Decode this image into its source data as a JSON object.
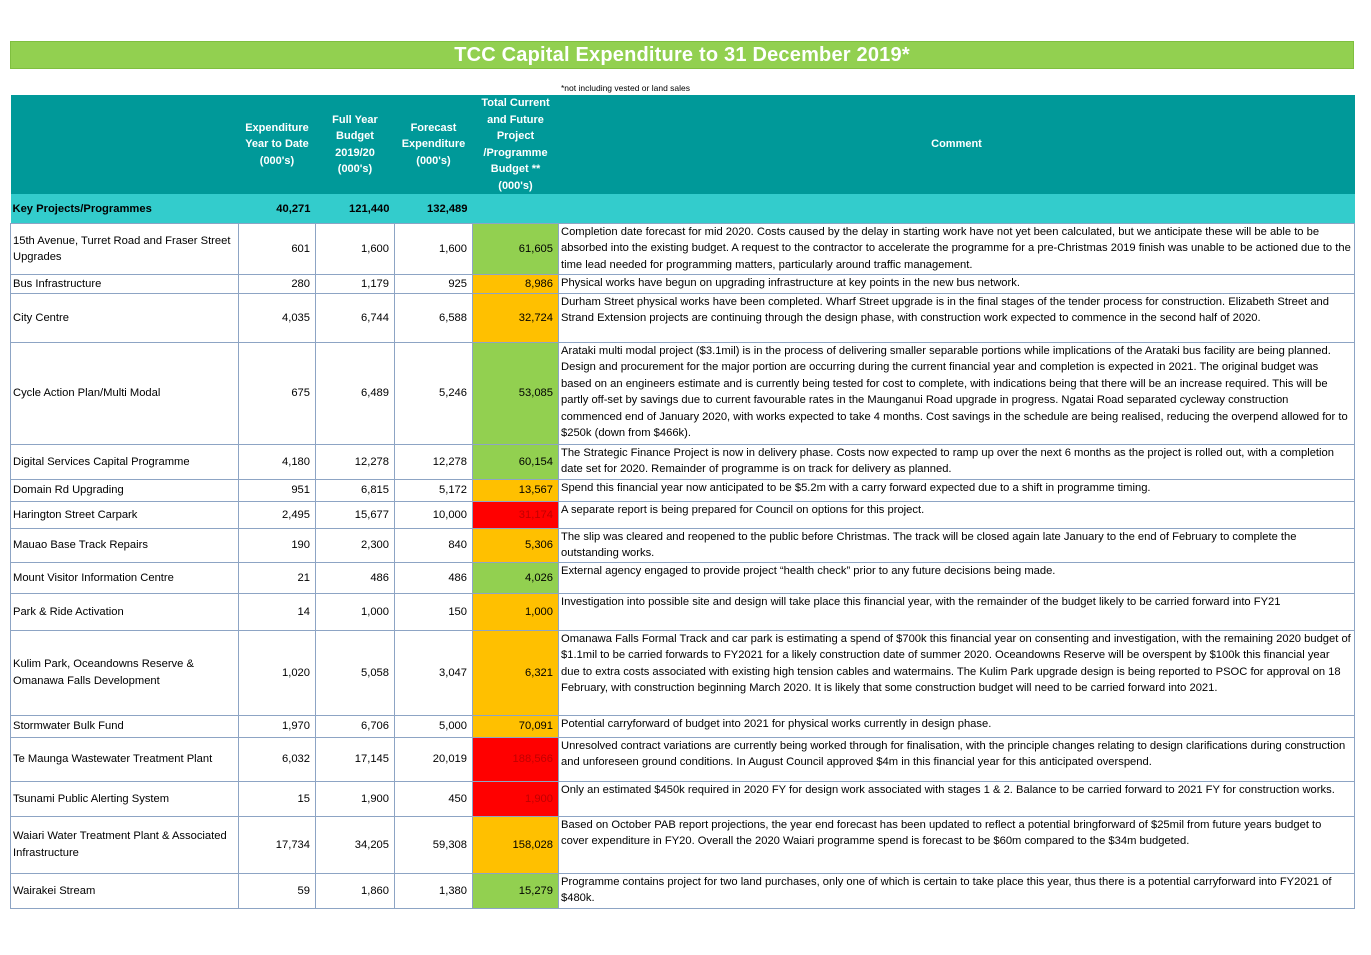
{
  "title": "TCC Capital Expenditure to 31 December 2019*",
  "footnote": "*not including vested or land sales",
  "headers": {
    "expenditure_ytd": "Expenditure Year to Date (000's)",
    "full_year_budget": "Full Year Budget 2019/20 (000's)",
    "forecast": "Forecast Expenditure (000's)",
    "total_budget": "Total Current and Future Project /Programme Budget ** (000's)",
    "comment": "Comment"
  },
  "key_row": {
    "label": "Key Projects/Programmes",
    "expenditure_ytd": "40,271",
    "full_year_budget": "121,440",
    "forecast": "132,489"
  },
  "status_colors": {
    "green": "#92d050",
    "amber": "#ffc000",
    "red": "#ff0000"
  },
  "rows": [
    {
      "name": "15th Avenue, Turret Road and Fraser Street Upgrades",
      "ytd": "601",
      "budget": "1,600",
      "forecast": "1,600",
      "total": "61,605",
      "status": "green",
      "comment": "Completion date forecast for mid 2020.  Costs caused by the delay in starting work have not yet been calculated, but we anticipate these will be able to be absorbed into the existing budget.  A request to the contractor to accelerate the programme for a pre-Christmas 2019 finish was unable to be actioned due to the time lead needed for programming matters, particularly around traffic management."
    },
    {
      "name": "Bus Infrastructure",
      "ytd": "280",
      "budget": "1,179",
      "forecast": "925",
      "total": "8,986",
      "status": "amber",
      "comment": "Physical works have begun on upgrading infrastructure at key points in the new bus network."
    },
    {
      "name": "City Centre",
      "ytd": "4,035",
      "budget": "6,744",
      "forecast": "6,588",
      "total": "32,724",
      "status": "amber",
      "comment": "Durham Street physical works have been completed.  Wharf Street upgrade is in the final stages of the tender process for construction.  Elizabeth Street and Strand Extension projects are continuing through the design phase, with construction work expected to commence in the second half of 2020."
    },
    {
      "name": "Cycle Action Plan/Multi Modal",
      "ytd": "675",
      "budget": "6,489",
      "forecast": "5,246",
      "total": "53,085",
      "status": "green",
      "comment": "Arataki multi modal project ($3.1mil) is in the process of delivering smaller separable portions while implications of the Arataki bus facility are being planned. Design and procurement for the major portion are occurring during the current financial year and completion is expected in 2021.  The original budget was based on an engineers estimate and is currently being tested for cost to complete, with indications being that there will be an increase required.  This will be partly off-set by savings due to current favourable rates in the Maunganui Road upgrade in progress.  Ngatai Road separated cycleway construction commenced end of January 2020, with works expected to take 4 months.  Cost savings in the schedule are being realised, reducing the overpend allowed for to $250k (down from $466k)."
    },
    {
      "name": "Digital Services Capital Programme",
      "ytd": "4,180",
      "budget": "12,278",
      "forecast": "12,278",
      "total": "60,154",
      "status": "green",
      "comment": "The Strategic Finance Project is now in delivery phase.  Costs now expected to ramp up over the next 6 months as the project is rolled out, with a completion date set for 2020.  Remainder of programme is on track for delivery as planned."
    },
    {
      "name": "Domain Rd Upgrading",
      "ytd": "951",
      "budget": "6,815",
      "forecast": "5,172",
      "total": "13,567",
      "status": "amber",
      "comment": "Spend this financial year now anticipated to be $5.2m with a carry forward expected due to a shift in programme timing."
    },
    {
      "name": "Harington Street Carpark",
      "ytd": "2,495",
      "budget": "15,677",
      "forecast": "10,000",
      "total": "31,174",
      "status": "red",
      "comment": "A separate report is being prepared for Council on options for this project."
    },
    {
      "name": "Mauao Base Track Repairs",
      "ytd": "190",
      "budget": "2,300",
      "forecast": "840",
      "total": "5,306",
      "status": "amber",
      "comment": "The slip was cleared and reopened to the public before Christmas.  The track will be closed again late January to the end of February to complete the outstanding works."
    },
    {
      "name": "Mount Visitor Information Centre",
      "ytd": "21",
      "budget": "486",
      "forecast": "486",
      "total": "4,026",
      "status": "green",
      "comment": "External agency engaged to provide project “health check” prior to any future decisions being made."
    },
    {
      "name": "Park & Ride Activation",
      "ytd": "14",
      "budget": "1,000",
      "forecast": "150",
      "total": "1,000",
      "status": "amber",
      "comment": "Investigation into possible site and design will take place this financial year, with the remainder of the budget likely to be carried forward into FY21"
    },
    {
      "name": "Kulim Park, Oceandowns Reserve & Omanawa Falls Development",
      "ytd": "1,020",
      "budget": "5,058",
      "forecast": "3,047",
      "total": "6,321",
      "status": "amber",
      "comment": "Omanawa Falls Formal Track and car park is estimating a spend of $700k this financial year on consenting and investigation, with the remaining 2020 budget of $1.1mil to be carried forwards to FY2021 for a likely construction date of summer 2020.  Oceandowns Reserve will be overspent by $100k this financial year due to extra costs associated with existing high tension cables and watermains. The Kulim Park upgrade design is being reported to PSOC for approval on 18 February, with construction beginning March 2020. It is likely that some construction budget will need to be carried forward into 2021."
    },
    {
      "name": "Stormwater Bulk Fund",
      "ytd": "1,970",
      "budget": "6,706",
      "forecast": "5,000",
      "total": "70,091",
      "status": "amber",
      "comment": "Potential carryforward of budget into 2021 for physical works currently in design phase."
    },
    {
      "name": "Te Maunga Wastewater Treatment Plant",
      "ytd": "6,032",
      "budget": "17,145",
      "forecast": "20,019",
      "total": "188,566",
      "status": "red",
      "comment": "Unresolved contract variations are currently being worked through for finalisation, with the principle changes relating to design clarifications during construction and unforeseen ground conditions.  In August Council approved $4m in this financial year for this anticipated overspend."
    },
    {
      "name": "Tsunami Public Alerting System",
      "ytd": "15",
      "budget": "1,900",
      "forecast": "450",
      "total": "1,900",
      "status": "red",
      "comment": "Only an estimated $450k required in 2020 FY for design work associated with stages 1 & 2. Balance to be carried forward to 2021 FY for construction works."
    },
    {
      "name": "Waiari Water Treatment Plant & Associated Infrastructure",
      "ytd": "17,734",
      "budget": "34,205",
      "forecast": "59,308",
      "total": "158,028",
      "status": "amber",
      "comment": "Based on October PAB report projections, the year end forecast has been updated to reflect a potential bringforward of $25mil from future years budget to cover expenditure in FY20.  Overall the 2020 Waiari programme spend is forecast to be $60m compared to the $34m budgeted."
    },
    {
      "name": "Wairakei Stream",
      "ytd": "59",
      "budget": "1,860",
      "forecast": "1,380",
      "total": "15,279",
      "status": "green",
      "comment": "Programme contains project for two land purchases, only one of which is certain to take place this year, thus there is a potential carryforward into FY2021 of $480k."
    }
  ]
}
